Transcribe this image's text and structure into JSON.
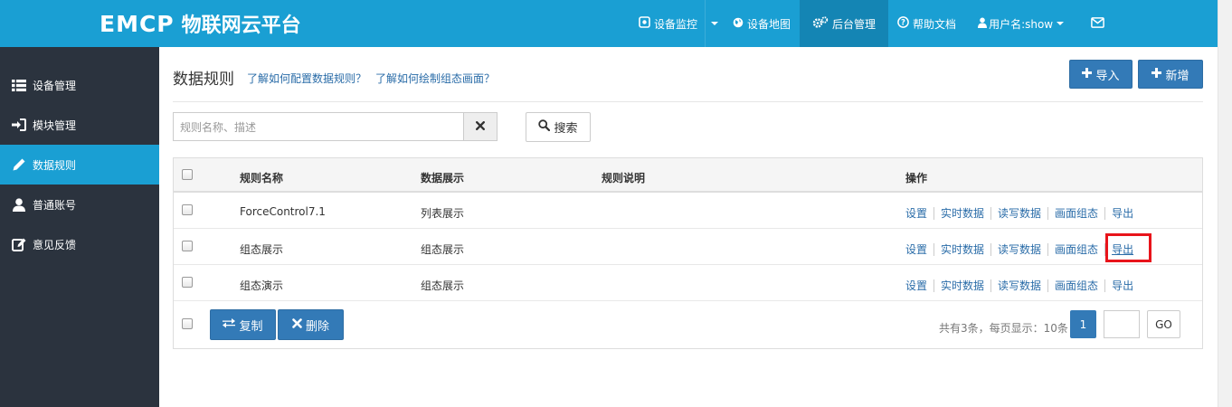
{
  "app": {
    "logo_mark": "EMCP",
    "logo_text": "物联网云平台"
  },
  "nav": {
    "items": [
      {
        "label": "设备监控",
        "icon": "monitor-icon"
      },
      {
        "label": "设备地图",
        "icon": "globe-icon"
      },
      {
        "label": "后台管理",
        "icon": "gears-icon",
        "active": true
      },
      {
        "label": "帮助文档",
        "icon": "help-icon"
      },
      {
        "label": "用户名:show",
        "icon": "user-icon"
      },
      {
        "label": "",
        "icon": "mail-icon"
      }
    ]
  },
  "sidebar": {
    "items": [
      {
        "label": "设备管理",
        "icon": "list-icon"
      },
      {
        "label": "模块管理",
        "icon": "sign-in-icon"
      },
      {
        "label": "数据规则",
        "icon": "pencil-icon",
        "active": true
      },
      {
        "label": "普通账号",
        "icon": "user-icon"
      },
      {
        "label": "意见反馈",
        "icon": "edit-icon"
      }
    ]
  },
  "main": {
    "title": "数据规则",
    "help_links": [
      "了解如何配置数据规则？",
      "了解如何绘制组态画面？"
    ],
    "import_label": "导入",
    "add_label": "新增"
  },
  "search": {
    "placeholder": "规则名称、描述",
    "button_label": "搜索"
  },
  "table": {
    "headers": [
      "规则名称",
      "数据展示",
      "规则说明",
      "操作"
    ],
    "rows": [
      {
        "name": "ForceControl7.1",
        "display": "列表展示",
        "desc": ""
      },
      {
        "name": "组态展示",
        "display": "组态展示",
        "desc": ""
      },
      {
        "name": "组态演示",
        "display": "组态展示",
        "desc": ""
      }
    ],
    "actions": [
      "设置",
      "实时数据",
      "读写数据",
      "画面组态",
      "导出"
    ]
  },
  "footer": {
    "copy_label": "复制",
    "delete_label": "删除",
    "total_text": "共有3条，每页显示：10条",
    "current_page": "1",
    "go_label": "GO"
  },
  "colors": {
    "topbar": "#1a9fd3",
    "sidebar": "#2b333e",
    "primary": "#337ab7",
    "highlight": "#e8141b"
  }
}
